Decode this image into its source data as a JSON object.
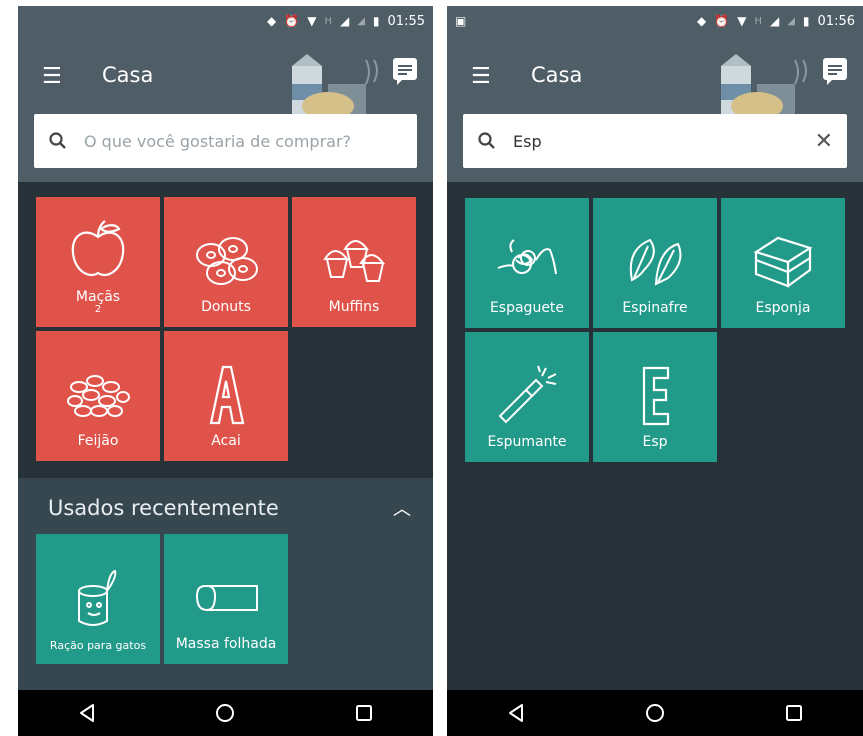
{
  "left": {
    "status": {
      "time": "01:55",
      "signal_label": "H"
    },
    "appbar": {
      "title": "Casa"
    },
    "search": {
      "placeholder": "O que você gostaria de comprar?",
      "value": ""
    },
    "items": [
      {
        "label": "Maçãs",
        "sub": "2",
        "icon": "apple-icon"
      },
      {
        "label": "Donuts",
        "icon": "donuts-icon"
      },
      {
        "label": "Muffins",
        "icon": "muffins-icon"
      },
      {
        "label": "Feijão",
        "icon": "beans-icon"
      },
      {
        "label": "Acai",
        "icon": "letter-a-icon"
      }
    ],
    "recent": {
      "title": "Usados recentemente",
      "items": [
        {
          "label": "Ração para gatos",
          "icon": "cat-food-icon"
        },
        {
          "label": "Massa folhada",
          "icon": "pastry-icon"
        }
      ]
    }
  },
  "right": {
    "status": {
      "time": "01:56",
      "signal_label": "H"
    },
    "appbar": {
      "title": "Casa"
    },
    "search": {
      "value": "Esp",
      "clear": "✕"
    },
    "items": [
      {
        "label": "Espaguete",
        "icon": "spaghetti-icon"
      },
      {
        "label": "Espinafre",
        "icon": "spinach-icon"
      },
      {
        "label": "Esponja",
        "icon": "sponge-icon"
      },
      {
        "label": "Espumante",
        "icon": "champagne-icon"
      },
      {
        "label": "Esp",
        "icon": "letter-e-icon"
      }
    ]
  },
  "colors": {
    "red_tile": "#e0534a",
    "teal_tile": "#229a8a",
    "appbar": "#4e5d66",
    "background": "#263238"
  }
}
